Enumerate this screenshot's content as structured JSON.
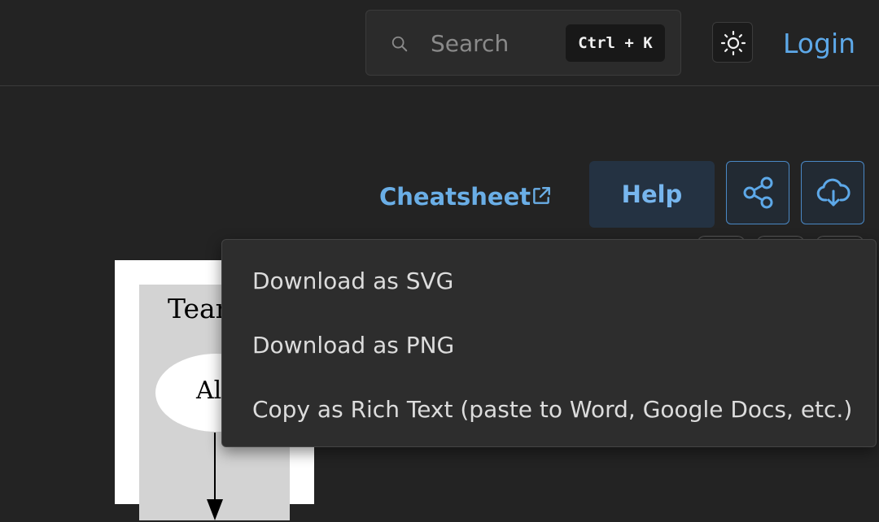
{
  "header": {
    "search": {
      "placeholder": "Search",
      "shortcut": "Ctrl + K"
    },
    "theme_toggle_icon": "sun-icon",
    "login_label": "Login"
  },
  "toolbar": {
    "cheatsheet_label": "Cheatsheet",
    "cheatsheet_icon": "external-link-icon",
    "help_label": "Help",
    "share_icon": "share-icon",
    "download_icon": "cloud-download-icon"
  },
  "diagram": {
    "cluster_label": "Tean",
    "node_label": "Al"
  },
  "download_menu": {
    "items": [
      {
        "label": "Download as SVG"
      },
      {
        "label": "Download as PNG"
      },
      {
        "label": "Copy as Rich Text (paste to Word, Google Docs, etc.)"
      }
    ]
  },
  "colors": {
    "background": "#232323",
    "accent": "#5da8e8",
    "menu_background": "#2d2d2d"
  }
}
